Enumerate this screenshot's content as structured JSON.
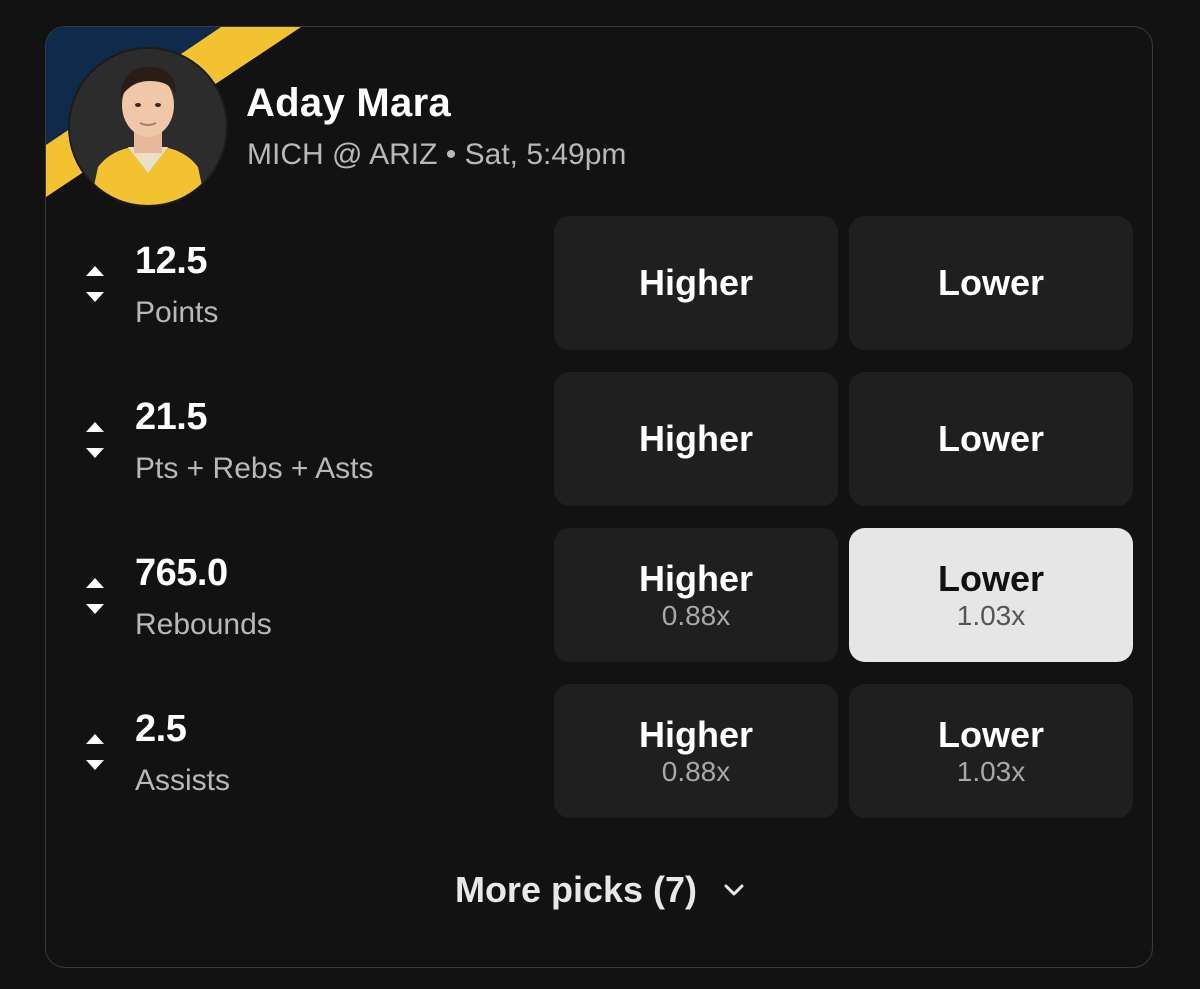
{
  "player": {
    "name": "Aday Mara",
    "matchup": "MICH @ ARIZ • Sat, 5:49pm",
    "avatar": "player-headshot",
    "team_colors": {
      "primary": "#0f2a4a",
      "accent": "#f2c230"
    }
  },
  "picks": [
    {
      "line": "12.5",
      "stat": "Points",
      "higher": {
        "label": "Higher",
        "multiplier": ""
      },
      "lower": {
        "label": "Lower",
        "multiplier": ""
      },
      "selected": ""
    },
    {
      "line": "21.5",
      "stat": "Pts + Rebs + Asts",
      "higher": {
        "label": "Higher",
        "multiplier": ""
      },
      "lower": {
        "label": "Lower",
        "multiplier": ""
      },
      "selected": ""
    },
    {
      "line": "765.0",
      "stat": "Rebounds",
      "higher": {
        "label": "Higher",
        "multiplier": "0.88x"
      },
      "lower": {
        "label": "Lower",
        "multiplier": "1.03x"
      },
      "selected": "lower"
    },
    {
      "line": "2.5",
      "stat": "Assists",
      "higher": {
        "label": "Higher",
        "multiplier": "0.88x"
      },
      "lower": {
        "label": "Lower",
        "multiplier": "1.03x"
      },
      "selected": ""
    }
  ],
  "more_picks": {
    "label": "More picks (7)",
    "icon": "chevron-down-icon"
  },
  "icons": {
    "sort": "sort-arrows-icon"
  },
  "colors": {
    "background": "#121212",
    "button": "#1f1f1f",
    "selected_button": "#e6e6e6"
  }
}
